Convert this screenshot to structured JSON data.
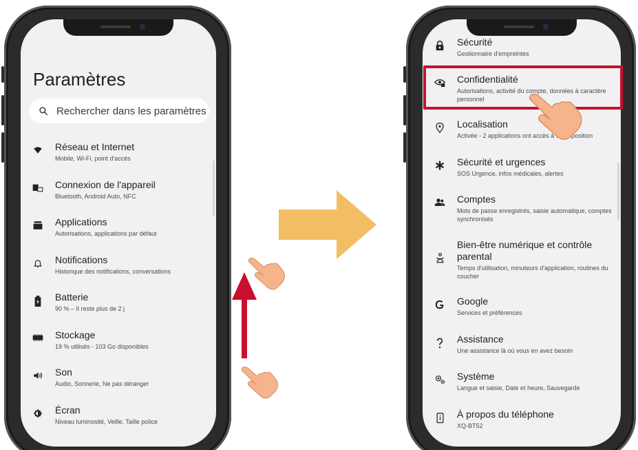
{
  "left_screen": {
    "title": "Paramètres",
    "search_placeholder": "Rechercher dans les paramètres",
    "items": [
      {
        "icon": "wifi-icon",
        "title": "Réseau et Internet",
        "subtitle": "Mobile, Wi-Fi, point d'accès"
      },
      {
        "icon": "devices-icon",
        "title": "Connexion de l'appareil",
        "subtitle": "Bluetooth, Android Auto, NFC"
      },
      {
        "icon": "apps-icon",
        "title": "Applications",
        "subtitle": "Autorisations, applications par défaut"
      },
      {
        "icon": "bell-icon",
        "title": "Notifications",
        "subtitle": "Historique des notifications, conversations"
      },
      {
        "icon": "battery-icon",
        "title": "Batterie",
        "subtitle": "90 % – Il reste plus de 2 j"
      },
      {
        "icon": "storage-icon",
        "title": "Stockage",
        "subtitle": "19 % utilisés - 103 Go disponibles"
      },
      {
        "icon": "volume-icon",
        "title": "Son",
        "subtitle": "Audio, Sonnerie, Ne pas déranger"
      },
      {
        "icon": "brightness-icon",
        "title": "Écran",
        "subtitle": "Niveau luminosité, Veille, Taille police"
      }
    ]
  },
  "right_screen": {
    "items": [
      {
        "icon": "lock-icon",
        "title": "Sécurité",
        "subtitle": "Gestionnaire d'empreintes"
      },
      {
        "icon": "privacy-eye-icon",
        "title": "Confidentialité",
        "subtitle": "Autorisations, activité du compte, données à caractère personnel",
        "highlighted": true
      },
      {
        "icon": "location-icon",
        "title": "Localisation",
        "subtitle": "Activée - 2 applications ont accès à votre position"
      },
      {
        "icon": "emergency-icon",
        "title": "Sécurité et urgences",
        "subtitle": "SOS Urgence, infos médicales, alertes"
      },
      {
        "icon": "accounts-icon",
        "title": "Comptes",
        "subtitle": "Mots de passe enregistrés, saisie automatique, comptes synchronisés"
      },
      {
        "icon": "wellbeing-icon",
        "title": "Bien-être numérique et contrôle parental",
        "subtitle": "Temps d'utilisation, minuteurs d'application, routines du coucher"
      },
      {
        "icon": "google-icon",
        "title": "Google",
        "subtitle": "Services et préférences"
      },
      {
        "icon": "help-icon",
        "title": "Assistance",
        "subtitle": "Une assistance là où vous en avez besoin"
      },
      {
        "icon": "system-gears-icon",
        "title": "Système",
        "subtitle": "Langue et saisie, Date et heure, Sauvegarde"
      },
      {
        "icon": "phone-info-icon",
        "title": "À propos du téléphone",
        "subtitle": "XQ-BT52"
      }
    ]
  },
  "colors": {
    "screen_bg": "#f1f1f3",
    "highlight": "#c8102e",
    "arrow_big": "#f2bd63",
    "arrow_up": "#c8102e",
    "hand": "#f5b48c"
  }
}
